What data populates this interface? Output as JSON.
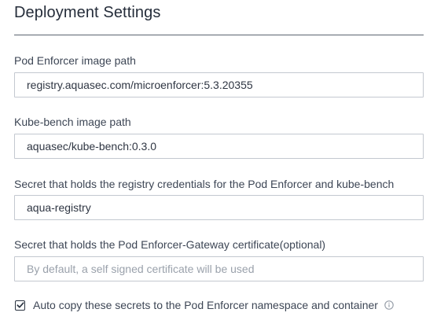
{
  "header": {
    "title": "Deployment Settings"
  },
  "fields": [
    {
      "label": "Pod Enforcer image path",
      "value": "registry.aquasec.com/microenforcer:5.3.20355",
      "placeholder": ""
    },
    {
      "label": "Kube-bench image path",
      "value": "aquasec/kube-bench:0.3.0",
      "placeholder": ""
    },
    {
      "label": "Secret that holds the registry credentials for the Pod Enforcer and kube-bench",
      "value": "aqua-registry",
      "placeholder": ""
    },
    {
      "label": "Secret that holds the Pod Enforcer-Gateway certificate(optional)",
      "value": "",
      "placeholder": "By default, a self signed certificate will be used"
    }
  ],
  "auto_copy": {
    "checked": true,
    "label": "Auto copy these secrets to the Pod Enforcer namespace and container",
    "info_icon": "info-circle-icon",
    "check_icon": "checkmark-icon"
  },
  "colors": {
    "text": "#3d4655",
    "title": "#252d3a",
    "border": "#c3c8d0",
    "placeholder": "#9aa1ab"
  }
}
